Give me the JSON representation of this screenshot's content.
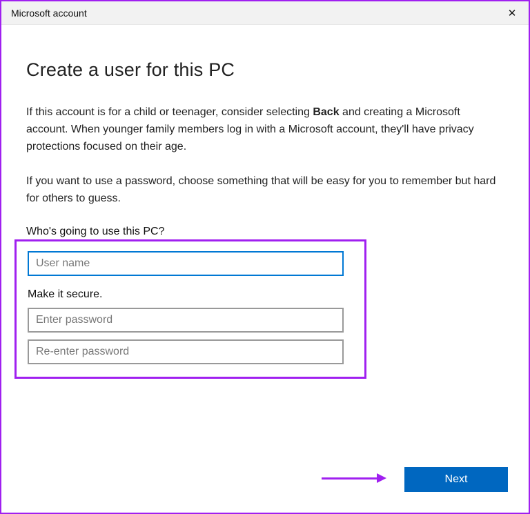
{
  "window": {
    "title": "Microsoft account",
    "close_icon": "✕"
  },
  "main": {
    "heading": "Create a user for this PC",
    "para1_a": "If this account is for a child or teenager, consider selecting ",
    "para1_bold": "Back",
    "para1_b": " and creating a Microsoft account. When younger family members log in with a Microsoft account, they'll have privacy protections focused on their age.",
    "para2": "If you want to use a password, choose something that will be easy for you to remember but hard for others to guess.",
    "who_label": "Who's going to use this PC?",
    "username_placeholder": "User name",
    "secure_label": "Make it secure.",
    "password_placeholder": "Enter password",
    "reenter_placeholder": "Re-enter password"
  },
  "footer": {
    "next_label": "Next"
  }
}
